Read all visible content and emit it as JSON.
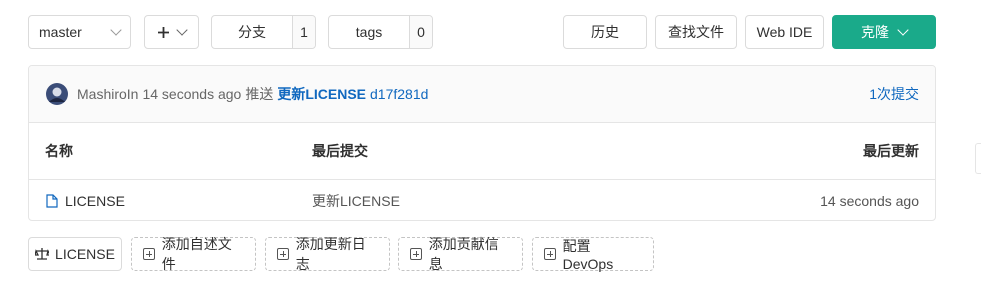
{
  "branch_selector": {
    "value": "master"
  },
  "add_button": {
    "icon": "plus-icon"
  },
  "branches": {
    "label": "分支",
    "count": "1"
  },
  "tags": {
    "label": "tags",
    "count": "0"
  },
  "actions": {
    "history": "历史",
    "find_file": "查找文件",
    "web_ide": "Web IDE",
    "clone": "克隆"
  },
  "last_commit": {
    "author": "MashiroIn",
    "time": "14 seconds ago",
    "verb": "推送",
    "message": "更新LICENSE",
    "sha": "d17f281d",
    "commit_count": "1次提交"
  },
  "table": {
    "headers": {
      "name": "名称",
      "last_commit": "最后提交",
      "last_update": "最后更新"
    },
    "rows": [
      {
        "name": "LICENSE",
        "commit": "更新LICENSE",
        "updated": "14 seconds ago"
      }
    ]
  },
  "bottom_actions": {
    "license": "LICENSE",
    "add_readme": "添加自述文件",
    "add_changelog": "添加更新日志",
    "add_contributing": "添加贡献信息",
    "configure_devops": "配置 DevOps"
  },
  "colors": {
    "primary": "#1aaa8a",
    "link": "#1068bf",
    "border": "#dbdbdb"
  }
}
